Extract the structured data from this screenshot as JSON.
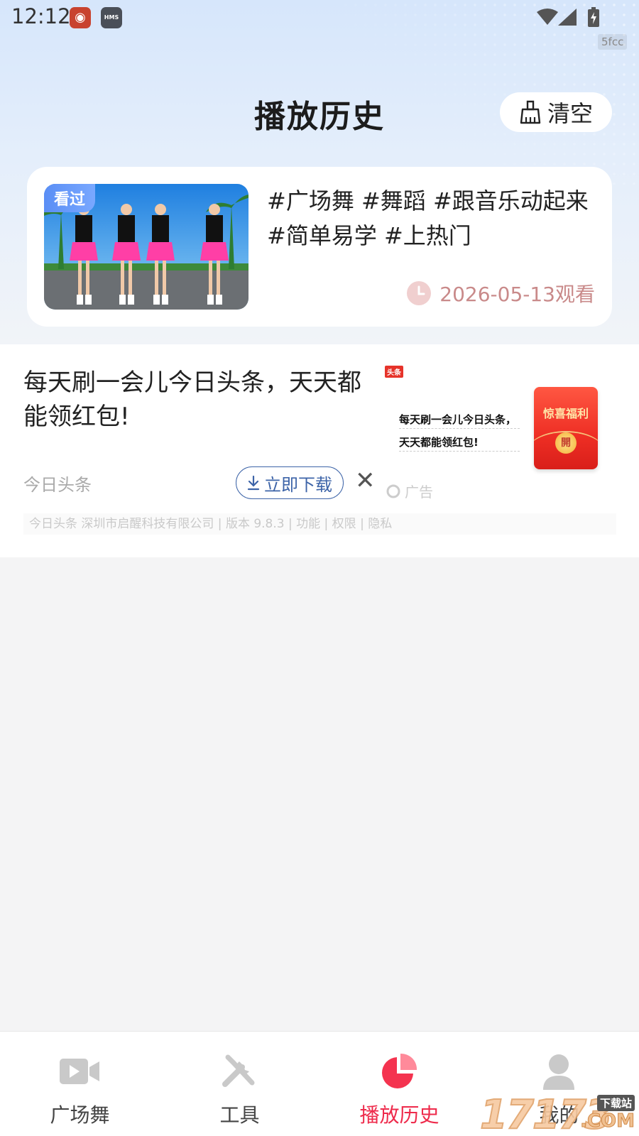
{
  "status_bar": {
    "time": "12:12",
    "corner_tag": "5fcc",
    "app_icons": [
      "weibo-icon",
      "hms-icon"
    ],
    "hms_label": "HMS"
  },
  "header": {
    "title": "播放历史",
    "clear_label": "清空"
  },
  "history": {
    "items": [
      {
        "badge": "看过",
        "title": "#广场舞 #舞蹈 #跟音乐动起来 #简单易学 #上热门",
        "watched": "2026-05-13观看"
      }
    ]
  },
  "ad": {
    "title": "每天刷一会儿今日头条，天天都能领红包!",
    "source": "今日头条",
    "download_label": "立即下载",
    "close_symbol": "✕",
    "ad_label": "广告",
    "footer": "今日头条 深圳市启醒科技有限公司 | 版本 9.8.3 | 功能 | 权限 | 隐私",
    "image": {
      "brand": "头条",
      "text_line1": "每天刷一会儿今日头条，",
      "text_line2": "天天都能领红包!",
      "packet_title": "惊喜福利",
      "packet_coin": "開"
    }
  },
  "bottom_nav": {
    "items": [
      {
        "label": "广场舞",
        "icon": "video-icon",
        "active": false
      },
      {
        "label": "工具",
        "icon": "tools-icon",
        "active": false
      },
      {
        "label": "播放历史",
        "icon": "pie-chart-icon",
        "active": true
      },
      {
        "label": "我的",
        "icon": "user-icon",
        "active": false
      }
    ]
  },
  "watermark": {
    "number": "17173",
    "top": "下载站",
    "domain": ".COM"
  },
  "colors": {
    "accent": "#ee2a4b",
    "date": "#c98a8a",
    "download": "#3d64a8"
  }
}
